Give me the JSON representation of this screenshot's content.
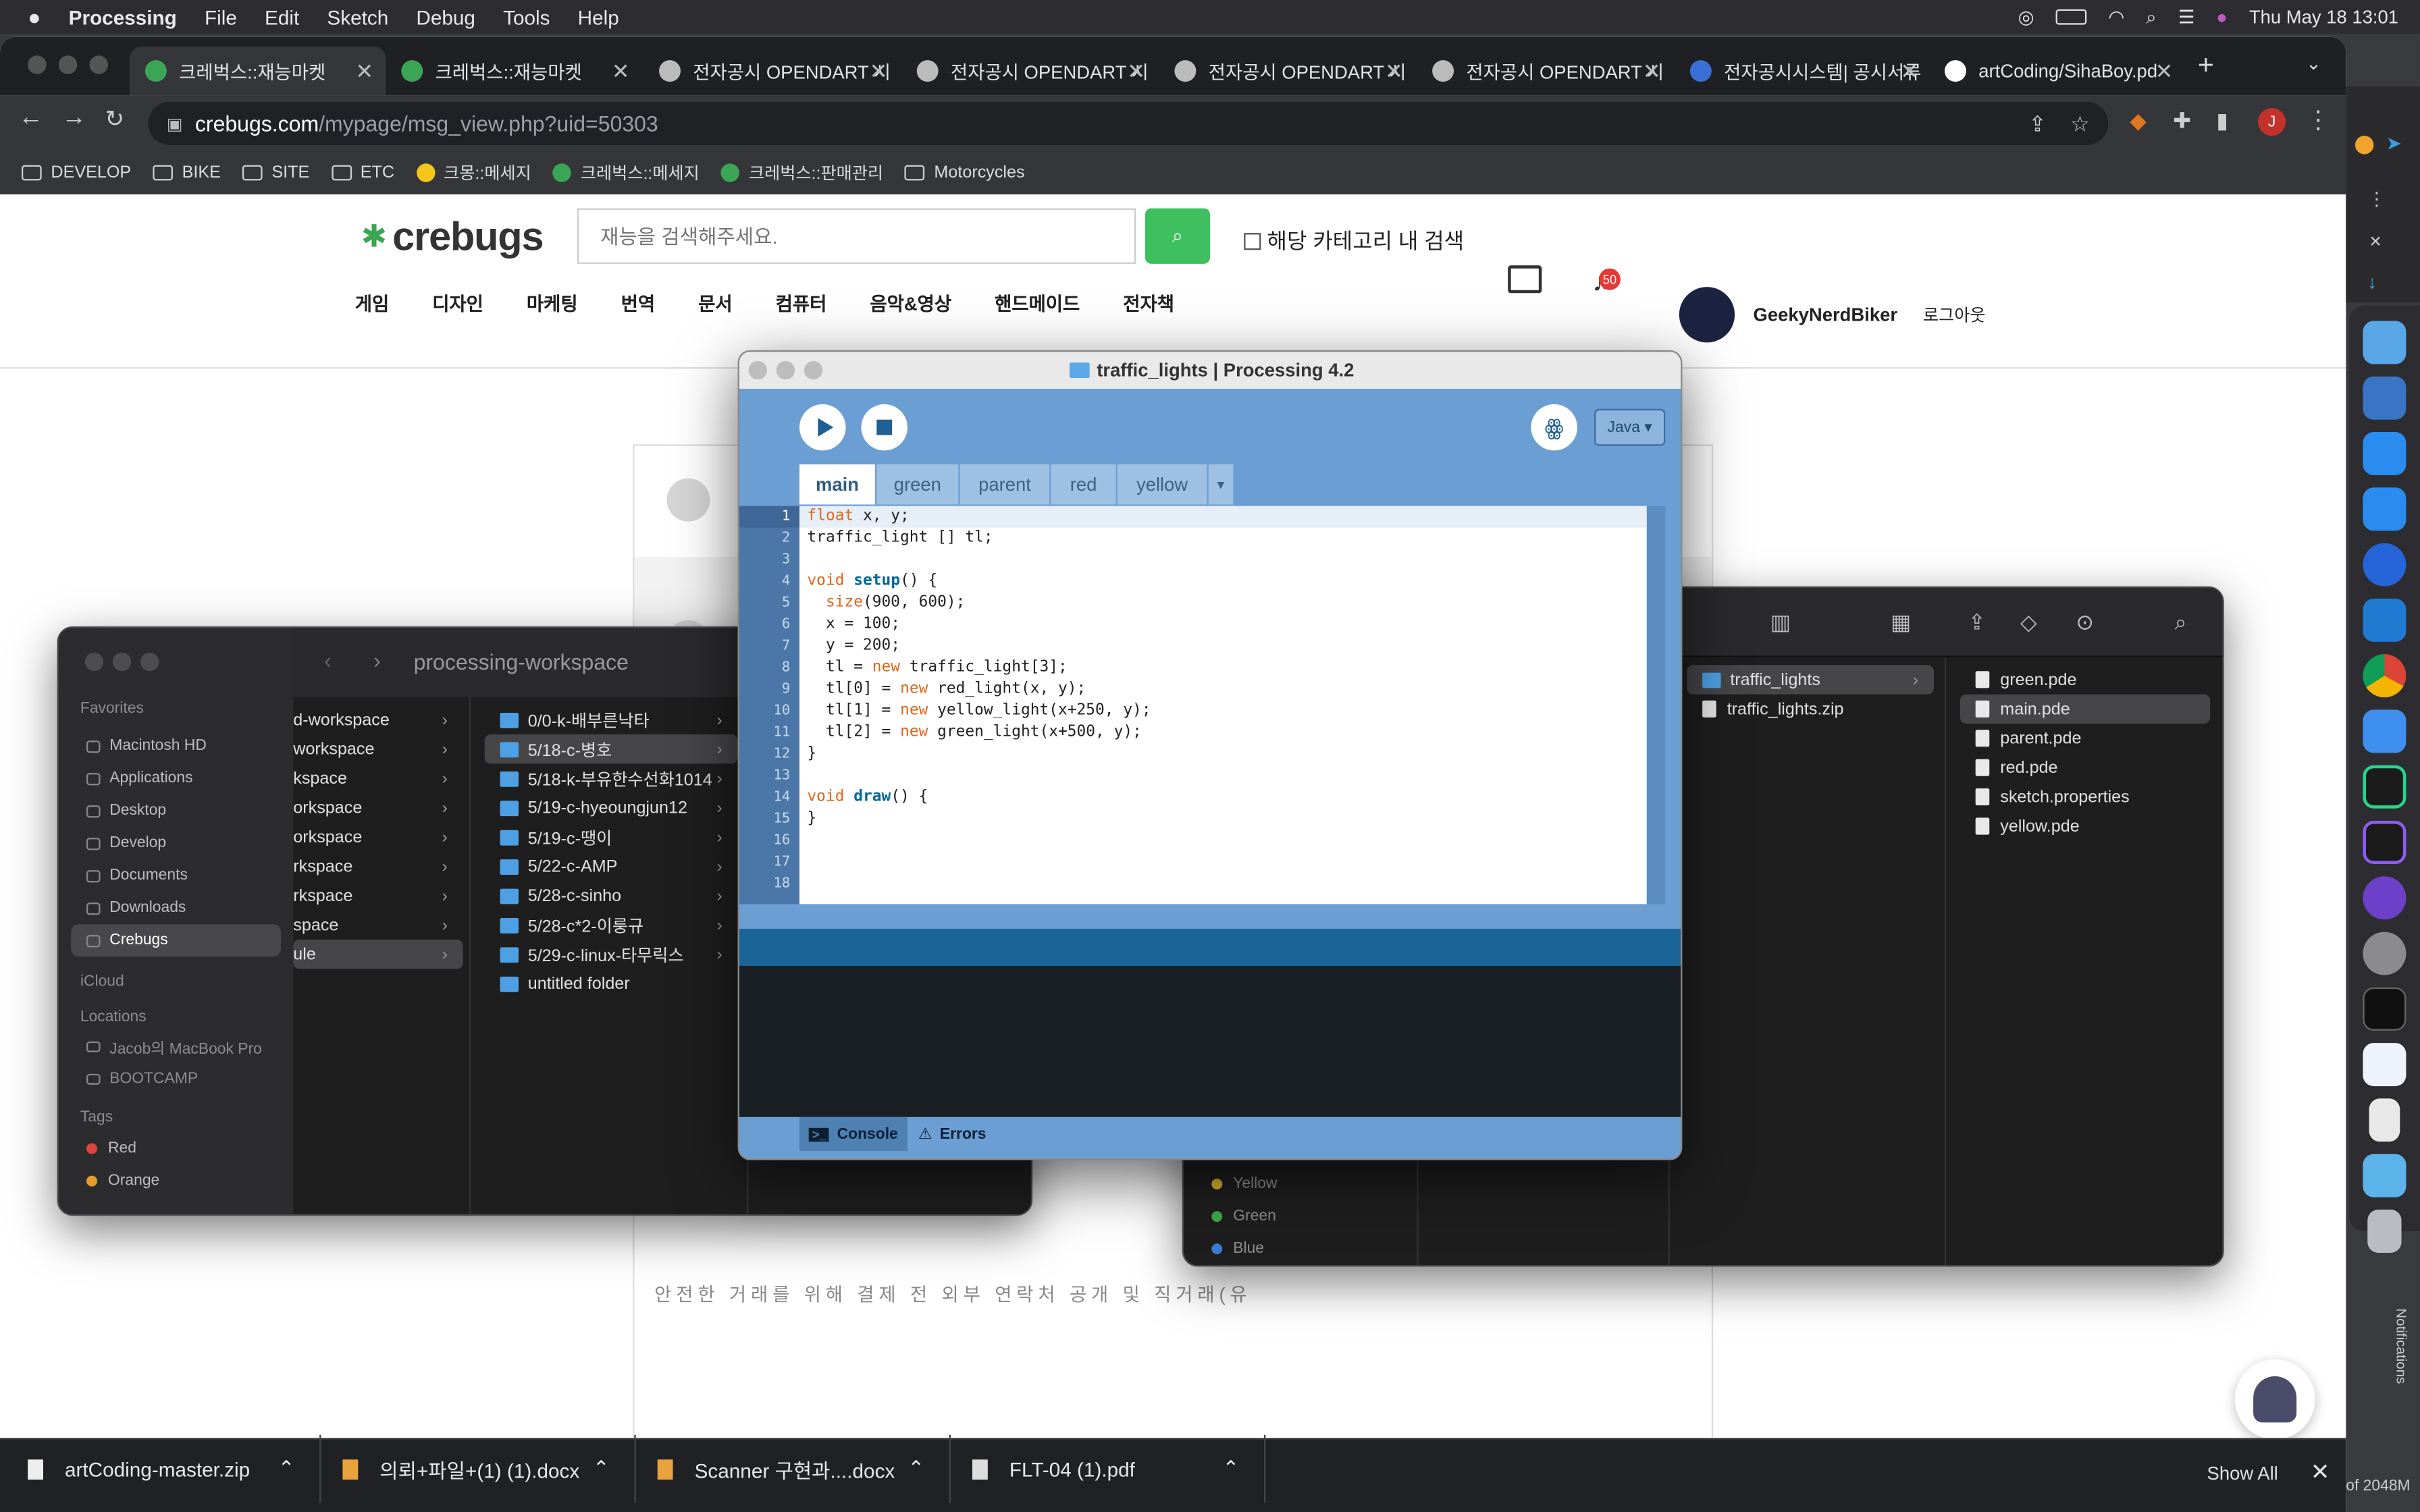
{
  "menubar": {
    "app": "Processing",
    "items": [
      "File",
      "Edit",
      "Sketch",
      "Debug",
      "Tools",
      "Help"
    ],
    "clock": "Thu May 18  13:01"
  },
  "chrome": {
    "tabs": [
      {
        "title": "크레벅스::재능마켓",
        "fav": "#3aa655"
      },
      {
        "title": "크레벅스::재능마켓",
        "fav": "#3aa655"
      },
      {
        "title": "전자공시 OPENDART 시",
        "fav": "#bbbbbb"
      },
      {
        "title": "전자공시 OPENDART 시",
        "fav": "#bbbbbb"
      },
      {
        "title": "전자공시 OPENDART 시",
        "fav": "#bbbbbb"
      },
      {
        "title": "전자공시 OPENDART 시",
        "fav": "#bbbbbb"
      },
      {
        "title": "전자공시시스템| 공시서류",
        "fav": "#3b6fd8"
      },
      {
        "title": "artCoding/SihaBoy.pd",
        "fav": "#ffffff"
      }
    ],
    "url_domain": "crebugs.com",
    "url_path": "/mypage/msg_view.php?uid=50303",
    "profile": "J",
    "bookmarks": [
      "DEVELOP",
      "BIKE",
      "SITE",
      "ETC",
      "크몽::메세지",
      "크레벅스::메세지",
      "크레벅스::판매관리",
      "Motorcycles"
    ]
  },
  "site": {
    "logo": "crebugs",
    "search_placeholder": "재능을 검색해주세요.",
    "category_check": "해당 카테고리 내 검색",
    "nav": [
      "게임",
      "디자인",
      "마케팅",
      "번역",
      "문서",
      "컴퓨터",
      "음악&영상",
      "핸드메이드",
      "전자책"
    ],
    "notif_count": "50",
    "username": "GeekyNerdBiker",
    "logout": "로그아웃",
    "notice": "안전한 거래를 위해 결제 전 외부 연락처 공개 및 직거래(유"
  },
  "finder_left": {
    "title": "processing-workspace",
    "sidebar": {
      "favorites_label": "Favorites",
      "favorites": [
        "Macintosh HD",
        "Applications",
        "Desktop",
        "Develop",
        "Documents",
        "Downloads",
        "Crebugs"
      ],
      "icloud_label": "iCloud",
      "locations_label": "Locations",
      "locations": [
        "Jacob의 MacBook Pro",
        "BOOTCAMP"
      ],
      "tags_label": "Tags",
      "tags": [
        {
          "name": "Red",
          "color": "#e0443c"
        },
        {
          "name": "Orange",
          "color": "#e89a2c"
        }
      ]
    },
    "col1": [
      "d-workspace",
      "workspace",
      "kspace",
      "orkspace",
      "orkspace",
      "rkspace",
      "rkspace",
      "space",
      "ule"
    ],
    "col2": [
      "0/0-k-배부른낙타",
      "5/18-c-병호",
      "5/18-k-부유한수선화1014",
      "5/19-c-hyeoungjun12",
      "5/19-c-땡이",
      "5/22-c-AMP",
      "5/28-c-sinho",
      "5/28-c*2-이룽규",
      "5/29-c-linux-타무릭스",
      "untitled folder"
    ]
  },
  "finder_right": {
    "col1": [
      "traffic_lights",
      "traffic_lights.zip"
    ],
    "col2": [
      "green.pde",
      "main.pde",
      "parent.pde",
      "red.pde",
      "sketch.properties",
      "yellow.pde"
    ],
    "tags": [
      {
        "name": "Yellow",
        "color": "#d6b52b"
      },
      {
        "name": "Green",
        "color": "#3cab4a"
      },
      {
        "name": "Blue",
        "color": "#3a7bd5"
      }
    ]
  },
  "processing": {
    "title": "traffic_lights | Processing 4.2",
    "mode": "Java ▾",
    "tabs": [
      "main",
      "green",
      "parent",
      "red",
      "yellow"
    ],
    "code": [
      "float x, y;",
      "traffic_light [] tl;",
      "",
      "void setup() {",
      "  size(900, 600);",
      "  x = 100;",
      "  y = 200;",
      "  tl = new traffic_light[3];",
      "  tl[0] = new red_light(x, y);",
      "  tl[1] = new yellow_light(x+250, y);",
      "  tl[2] = new green_light(x+500, y);",
      "}",
      "",
      "void draw() {",
      "}",
      "",
      "",
      ""
    ],
    "console": "Console",
    "errors": "Errors"
  },
  "downloads": {
    "items": [
      "artCoding-master.zip",
      "의뢰+파일+(1) (1).docx",
      "Scanner 구현과....docx",
      "FLT-04 (1).pdf"
    ],
    "show_all": "Show All",
    "side_text": "of 2048M"
  },
  "notifications_label": "Notifications"
}
